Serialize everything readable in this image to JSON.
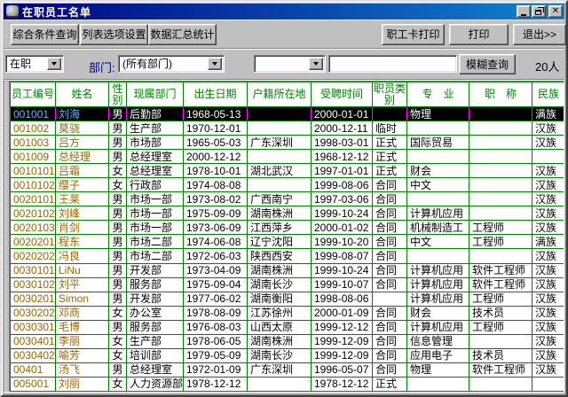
{
  "window": {
    "title": "在职员工名单"
  },
  "toolbar": {
    "buttons_left": [
      "综合条件查询",
      "列表选项设置",
      "数据汇总统计"
    ],
    "buttons_right": [
      "职工卡打印",
      "打印",
      "退出>>"
    ]
  },
  "filter": {
    "status_value": "在职",
    "dept_label": "部门:",
    "dept_value": "(所有部门)",
    "field_value": "",
    "keyword_value": "",
    "search_button": "模糊查询",
    "count": "20人"
  },
  "table": {
    "selected_row_index": 0,
    "columns": [
      {
        "key": "emp_id",
        "label": "员工编号"
      },
      {
        "key": "name",
        "label": "姓名"
      },
      {
        "key": "gender",
        "label": "性别"
      },
      {
        "key": "department",
        "label": "现属部门"
      },
      {
        "key": "birth_date",
        "label": "出生日期"
      },
      {
        "key": "household",
        "label": "户籍所在地"
      },
      {
        "key": "hire_date",
        "label": "受聘时间"
      },
      {
        "key": "category",
        "label": "职员类别"
      },
      {
        "key": "major",
        "label": "专　业"
      },
      {
        "key": "job_title",
        "label": "职　称"
      },
      {
        "key": "ethnicity",
        "label": "民族"
      }
    ],
    "rows": [
      [
        "001001",
        "刘海",
        "男",
        "后勤部",
        "1968-05-13",
        "",
        "2000-01-01",
        "",
        "物理",
        "",
        "满族"
      ],
      [
        "001002",
        "莫骁",
        "男",
        "生产部",
        "1970-12-01",
        "",
        "2000-12-11",
        "临时",
        "",
        "",
        "汉族"
      ],
      [
        "001003",
        "吕方",
        "男",
        "市场部",
        "1965-05-03",
        "广东深圳",
        "1998-03-01",
        "正式",
        "国际贸易",
        "",
        "汉族"
      ],
      [
        "001009",
        "总经理",
        "男",
        "总经理室",
        "2000-12-12",
        "",
        "1968-12-12",
        "正式",
        "",
        "",
        ""
      ],
      [
        "0010101",
        "吕霜",
        "女",
        "总经理室",
        "1978-10-01",
        "湖北武汉",
        "1997-01-01",
        "正式",
        "财会",
        "",
        "汉族"
      ],
      [
        "0010102",
        "缨子",
        "女",
        "行政部",
        "1974-08-08",
        "",
        "1999-08-06",
        "合同",
        "中文",
        "",
        "汉族"
      ],
      [
        "0020101",
        "王莱",
        "男",
        "市场一部",
        "1973-08-02",
        "广西南宁",
        "1997-03-06",
        "合同",
        "",
        "",
        "汉族"
      ],
      [
        "0020102",
        "刘峰",
        "男",
        "市场一部",
        "1975-09-09",
        "湖南株洲",
        "1999-10-24",
        "合同",
        "计算机应用",
        "",
        "汉族"
      ],
      [
        "0020103",
        "肖剑",
        "男",
        "市场一部",
        "1973-06-09",
        "江西萍乡",
        "2000-01-02",
        "合同",
        "机械制造工",
        "工程师",
        "汉族"
      ],
      [
        "0020201",
        "程东",
        "男",
        "市场二部",
        "1974-06-08",
        "辽宁沈阳",
        "1999-10-20",
        "合同",
        "中文",
        "工程师",
        "满族"
      ],
      [
        "0020202",
        "冯良",
        "男",
        "市场二部",
        "1972-06-03",
        "陕西西安",
        "1999-08-07",
        "合同",
        "",
        "",
        "汉族"
      ],
      [
        "0030101",
        "LiNu",
        "男",
        "开发部",
        "1973-04-09",
        "湖南株洲",
        "1999-10-24",
        "合同",
        "计算机应用",
        "软件工程师",
        "汉族"
      ],
      [
        "0030102",
        "刘平",
        "男",
        "服务部",
        "1975-09-04",
        "湖南长沙",
        "1999-10-07",
        "合同",
        "计算机应用",
        "软件工程师",
        "汉族"
      ],
      [
        "0030201",
        "Simon",
        "男",
        "开发部",
        "1977-06-02",
        "湖南衡阳",
        "1998-08-06",
        "",
        "计算机应用",
        "工程师",
        "汉族"
      ],
      [
        "0030202",
        "邓商",
        "女",
        "办公室",
        "1978-08-09",
        "江苏徐州",
        "2000-01-09",
        "合同",
        "财会",
        "技术员",
        "汉族"
      ],
      [
        "0030301",
        "毛博",
        "男",
        "服务部",
        "1976-08-03",
        "山西太原",
        "1999-12-12",
        "合同",
        "计算机应用",
        "工程师",
        "汉族"
      ],
      [
        "0030401",
        "李丽",
        "女",
        "生产部",
        "1978-06-05",
        "湖南株洲",
        "1999-12-09",
        "合同",
        "信息管理",
        "",
        "汉族"
      ],
      [
        "0030402",
        "喻芳",
        "女",
        "培训部",
        "1979-05-09",
        "湖南长沙",
        "1999-12-09",
        "合同",
        "应用电子",
        "技术员",
        "汉族"
      ],
      [
        "00401",
        "汤飞",
        "男",
        "总经理室",
        "1972-01-09",
        "广东深圳",
        "1996-05-07",
        "合同",
        "物理",
        "软件工程师",
        "汉族"
      ],
      [
        "005001",
        "刘丽",
        "女",
        "人力资源部",
        "1978-12-12",
        "",
        "1978-12-12",
        "正式",
        "",
        "",
        ""
      ]
    ]
  },
  "colors": {
    "titlebar_gradient_start": "#000080",
    "titlebar_gradient_end": "#1084d0",
    "grid_line": "#008000",
    "header_text": "#008000",
    "id_name_text": "#996600",
    "selected_bg": "#000000",
    "selected_text": "#ffffff",
    "selected_id_name_text": "#66b3ff",
    "selected_separator": "#ff00ff",
    "dept_label_text": "#000080",
    "chrome_bg": "#c0c0c0"
  }
}
